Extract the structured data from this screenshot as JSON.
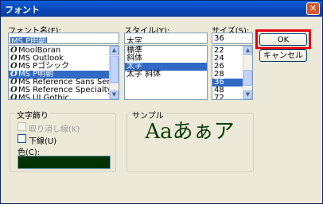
{
  "window": {
    "title": "フォント",
    "close_glyph": "✕"
  },
  "font": {
    "label": "フォント名(F):",
    "value": "MS P明朝",
    "items": [
      {
        "icon": "O",
        "name": "MoolBoran"
      },
      {
        "icon": "O",
        "name": "MS Outlook"
      },
      {
        "icon": "O",
        "name": "MS Pゴシック"
      },
      {
        "icon": "O",
        "name": "MS P明朝"
      },
      {
        "icon": "O",
        "name": "MS Reference Sans Serif"
      },
      {
        "icon": "O",
        "name": "MS Reference Specialty"
      },
      {
        "icon": "O",
        "name": "MS UI Gothic"
      }
    ],
    "selected_index": 3
  },
  "style": {
    "label": "スタイル(Y):",
    "value": "太字",
    "items": [
      "標準",
      "斜体",
      "太字",
      "太字 斜体"
    ],
    "selected_index": 2
  },
  "size": {
    "label": "サイズ(S):",
    "value": "36",
    "items": [
      "22",
      "24",
      "26",
      "28",
      "36",
      "48",
      "72"
    ],
    "selected_index": 4
  },
  "buttons": {
    "ok": "OK",
    "cancel": "キャンセル"
  },
  "effects": {
    "label": "文字飾り",
    "strikeout": "取り消し線(K)",
    "underline": "下線(U)",
    "color_label": "色(C):",
    "color": "#003300"
  },
  "sample": {
    "label": "サンプル",
    "text": "Aaあぁア",
    "color": "#0b3d0b"
  },
  "icons": {
    "font_type": "opentype-font-icon",
    "close": "close-icon",
    "scroll_up": "scroll-up-arrow-icon",
    "scroll_down": "scroll-down-arrow-icon"
  },
  "accent": {
    "highlight": "#e60012",
    "selection": "#316ac5",
    "title_bar": "#0946b8"
  }
}
